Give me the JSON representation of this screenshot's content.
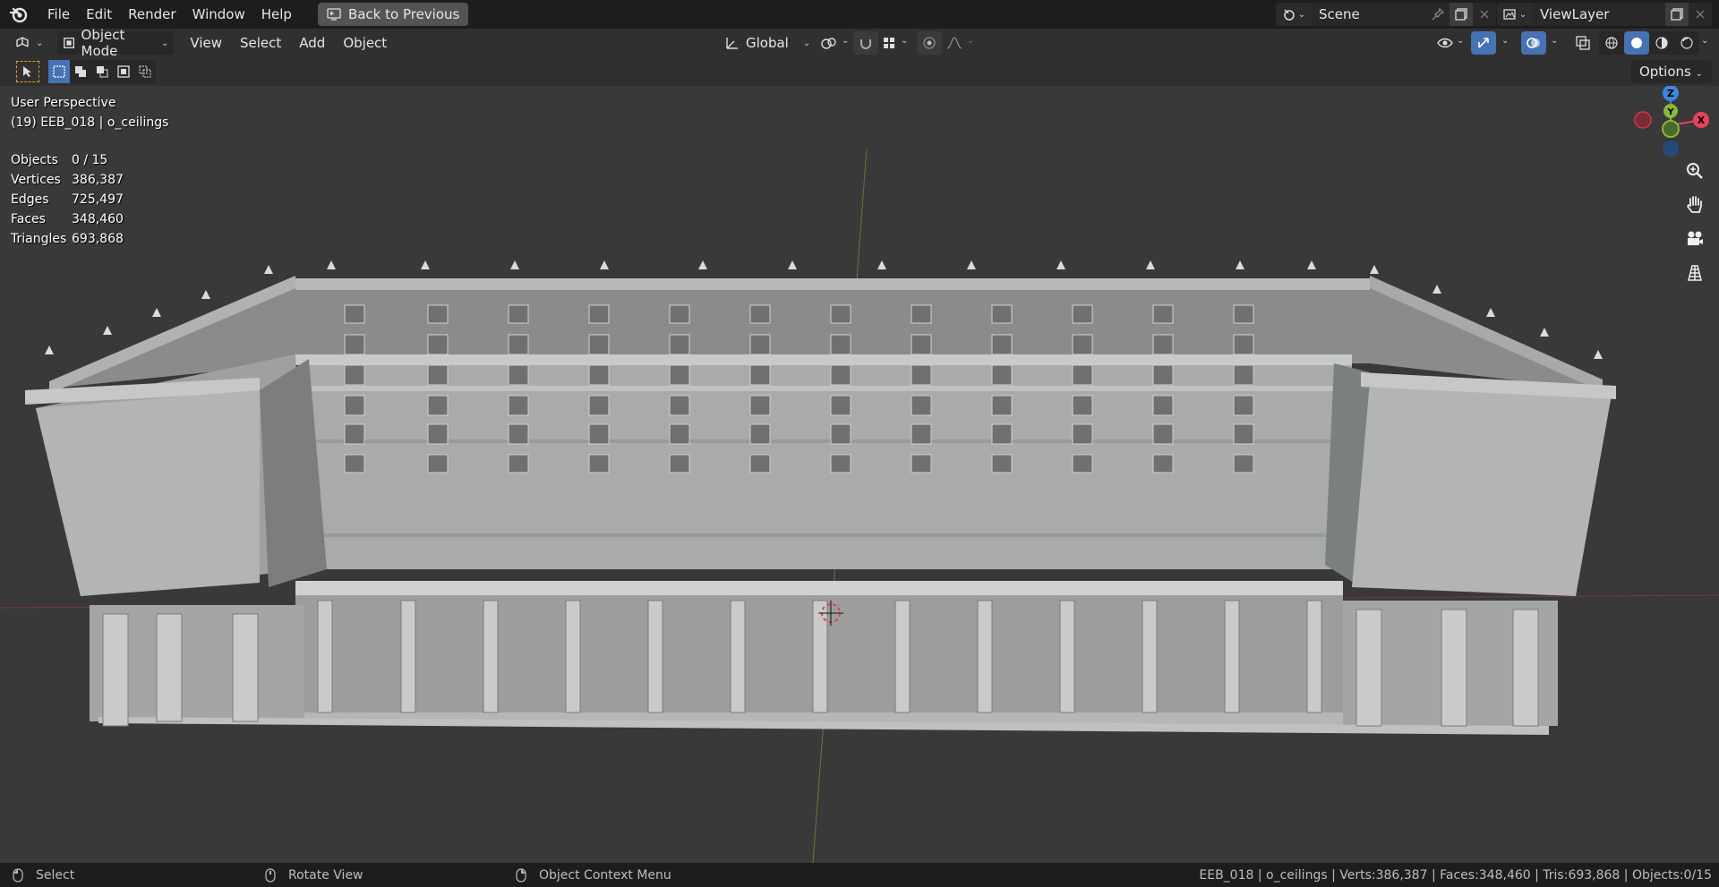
{
  "menu": {
    "items": [
      "File",
      "Edit",
      "Render",
      "Window",
      "Help"
    ],
    "back_label": "Back to Previous"
  },
  "scene": {
    "name": "Scene"
  },
  "view_layer": {
    "name": "ViewLayer"
  },
  "header": {
    "mode": "Object Mode",
    "view": "View",
    "select": "Select",
    "add": "Add",
    "object": "Object",
    "orientation": "Global"
  },
  "toolrow": {
    "options": "Options"
  },
  "viewport": {
    "perspective": "User Perspective",
    "object_info": "(19) EEB_018 | o_ceilings",
    "stats": [
      {
        "label": "Objects",
        "value": "0 / 15"
      },
      {
        "label": "Vertices",
        "value": "386,387"
      },
      {
        "label": "Edges",
        "value": "725,497"
      },
      {
        "label": "Faces",
        "value": "348,460"
      },
      {
        "label": "Triangles",
        "value": "693,868"
      }
    ],
    "gizmo": {
      "z": "Z",
      "y": "Y",
      "x": "X"
    }
  },
  "status": {
    "select": "Select",
    "rotate": "Rotate View",
    "context": "Object Context Menu",
    "info": "EEB_018 | o_ceilings | Verts:386,387 | Faces:348,460 | Tris:693,868 | Objects:0/15"
  },
  "colors": {
    "accent": "#4772b3",
    "axis_x": "#e8435c",
    "axis_y": "#8bb63c",
    "axis_z": "#3f87de"
  }
}
